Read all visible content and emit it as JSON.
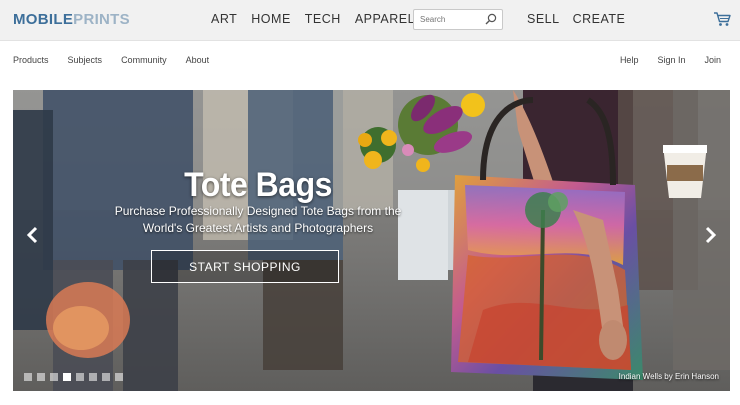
{
  "header": {
    "logo_part1": "MOBILE",
    "logo_part2": "PRINTS",
    "nav": [
      "ART",
      "HOME",
      "TECH",
      "APPAREL"
    ],
    "search_placeholder": "Search",
    "nav_right": [
      "SELL",
      "CREATE"
    ]
  },
  "subnav": {
    "left": [
      "Products",
      "Subjects",
      "Community",
      "About"
    ],
    "right": [
      "Help",
      "Sign In",
      "Join"
    ]
  },
  "hero": {
    "title": "Tote Bags",
    "subtitle_line1": "Purchase Professionally Designed Tote Bags from the",
    "subtitle_line2": "World's Greatest Artists and Photographers",
    "cta": "START SHOPPING",
    "caption": "Indian Wells by Erin Hanson",
    "slides": 8,
    "active_slide": 4
  },
  "colors": {
    "logo_primary": "#3d6f9a",
    "logo_secondary": "#9db3c6",
    "header_bg": "#f1f1f1"
  }
}
